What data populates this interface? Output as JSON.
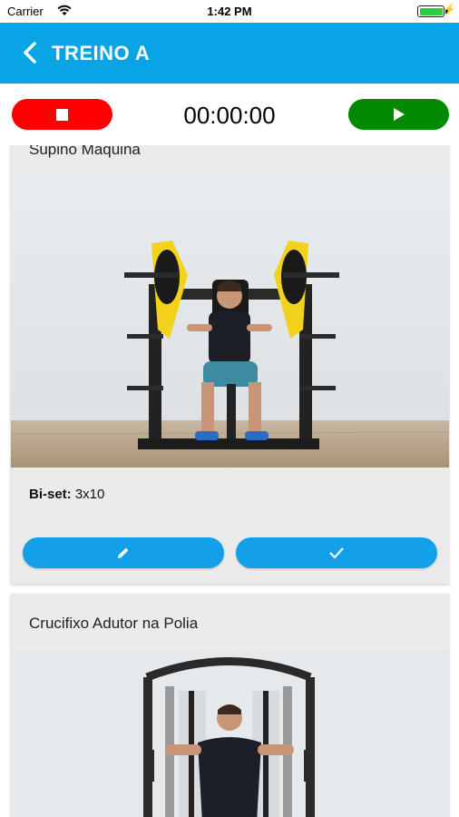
{
  "status_bar": {
    "carrier": "Carrier",
    "time": "1:42 PM"
  },
  "header": {
    "title": "TREINO A"
  },
  "timer": {
    "display": "00:00:00"
  },
  "exercises": [
    {
      "name": "Supino Maquina",
      "type_label": "Bi-set:",
      "sets": "3x10"
    },
    {
      "name": "Crucifixo Adutor na Polia"
    }
  ],
  "colors": {
    "header": "#09a4e4",
    "stop": "#ff0000",
    "play": "#008a00",
    "action": "#12a0ea"
  },
  "icons": [
    "chevron-left-icon",
    "stop-icon",
    "play-icon",
    "pencil-icon",
    "check-icon",
    "wifi-icon",
    "battery-icon"
  ]
}
